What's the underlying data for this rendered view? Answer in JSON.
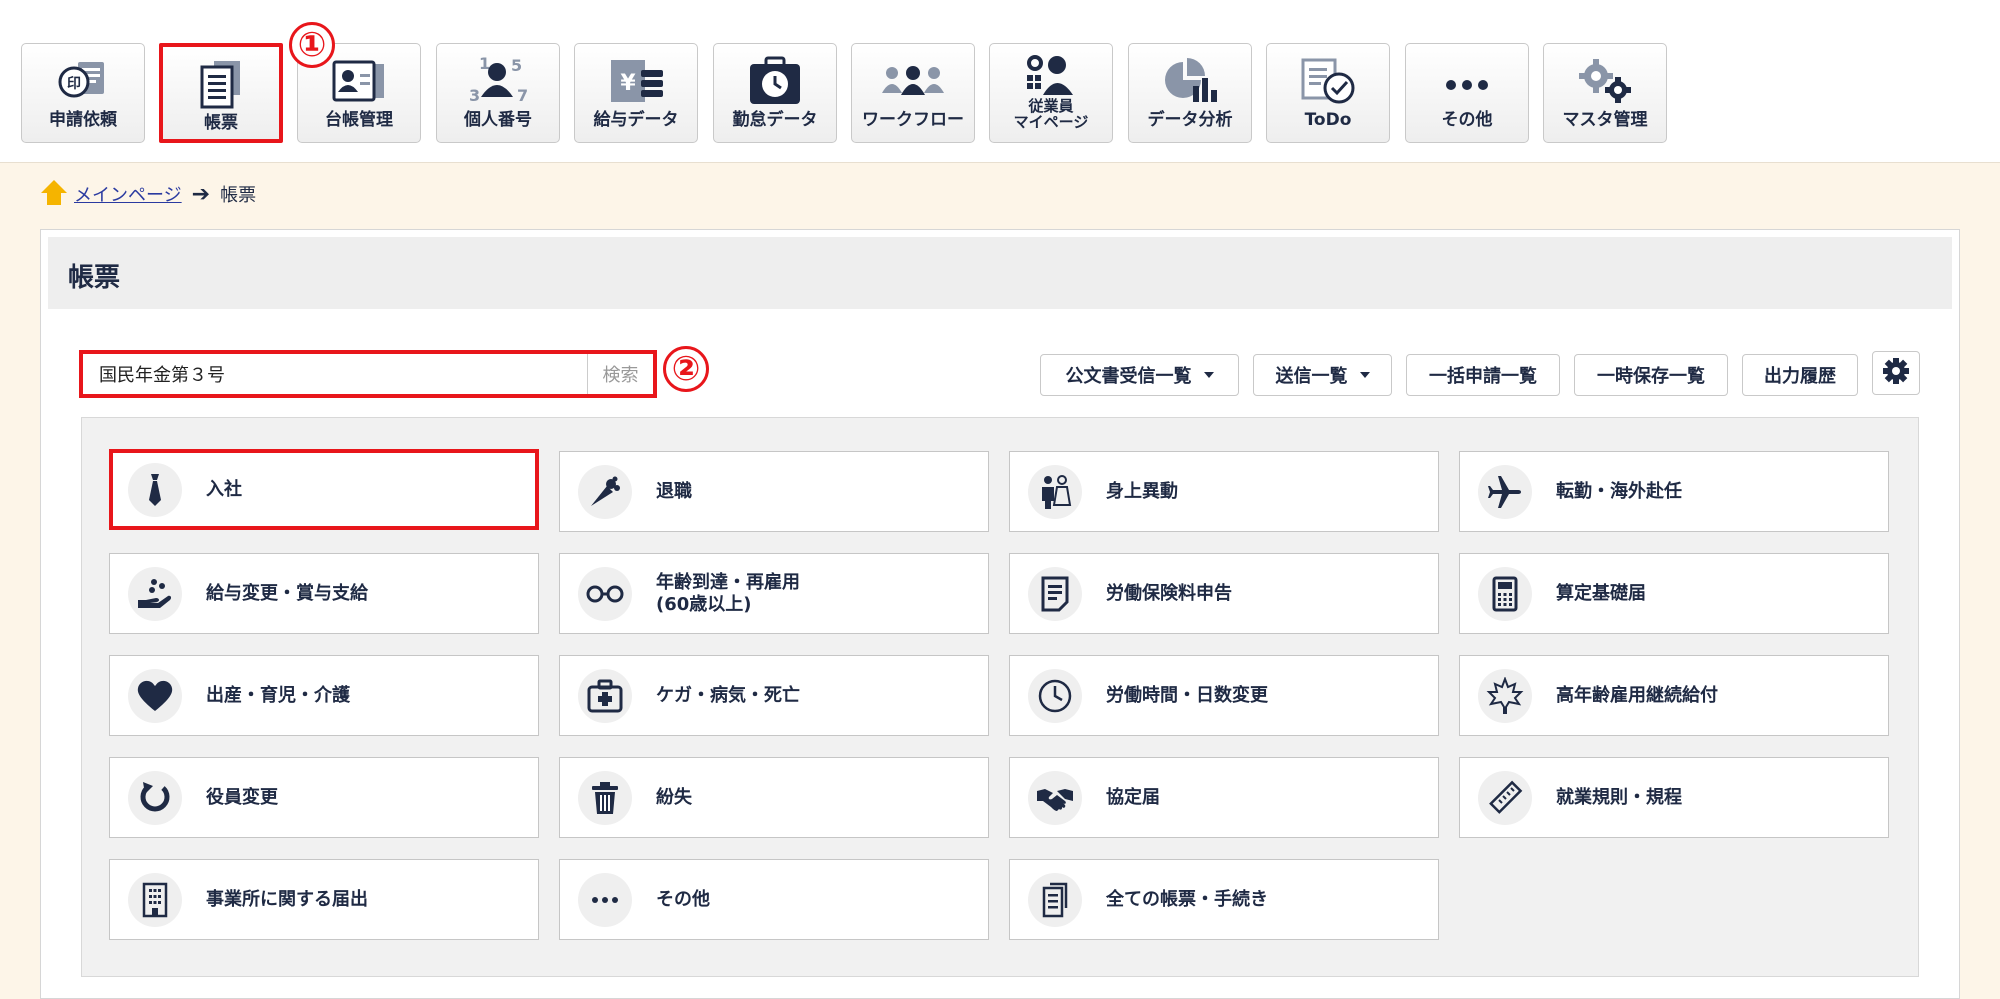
{
  "nav": {
    "items": [
      {
        "label": "申請依頼",
        "icon": "application-stamp-icon"
      },
      {
        "label": "帳票",
        "icon": "document-icon"
      },
      {
        "label": "台帳管理",
        "icon": "ledger-card-icon"
      },
      {
        "label": "個人番号",
        "icon": "personal-number-icon"
      },
      {
        "label": "給与データ",
        "icon": "salary-data-icon"
      },
      {
        "label": "勤怠データ",
        "icon": "attendance-clock-icon"
      },
      {
        "label": "ワークフロー",
        "icon": "workflow-icon"
      },
      {
        "label": "従業員\nマイページ",
        "icon": "employee-mypage-icon"
      },
      {
        "label": "データ分析",
        "icon": "data-analysis-icon"
      },
      {
        "label": "ToDo",
        "icon": "todo-check-icon"
      },
      {
        "label": "その他",
        "icon": "more-dots-icon"
      },
      {
        "label": "マスタ管理",
        "icon": "master-gear-icon"
      }
    ],
    "active_index": 1,
    "marker_1": "①",
    "marker_2": "②"
  },
  "breadcrumb": {
    "home": "メインページ",
    "current": "帳票"
  },
  "panel": {
    "title": "帳票"
  },
  "search": {
    "value": "国民年金第３号",
    "button": "検索"
  },
  "toolbar": {
    "incoming": "公文書受信一覧",
    "sent": "送信一覧",
    "bulk": "一括申請一覧",
    "temp": "一時保存一覧",
    "history": "出力履歴",
    "settings_icon": "gear-icon"
  },
  "categories": [
    {
      "label": "入社",
      "icon": "necktie-icon",
      "highlighted": true
    },
    {
      "label": "退職",
      "icon": "bouquet-icon"
    },
    {
      "label": "身上異動",
      "icon": "wedding-couple-icon"
    },
    {
      "label": "転勤・海外赴任",
      "icon": "airplane-icon"
    },
    {
      "label": "給与変更・賞与支給",
      "icon": "hand-coins-icon"
    },
    {
      "label": "年齢到達・再雇用\n(60歳以上)",
      "icon": "glasses-icon"
    },
    {
      "label": "労働保険料申告",
      "icon": "document-lines-icon"
    },
    {
      "label": "算定基礎届",
      "icon": "calculator-icon"
    },
    {
      "label": "出産・育児・介護",
      "icon": "heart-icon"
    },
    {
      "label": "ケガ・病気・死亡",
      "icon": "first-aid-kit-icon"
    },
    {
      "label": "労働時間・日数変更",
      "icon": "clock-icon"
    },
    {
      "label": "高年齢雇用継続給付",
      "icon": "maple-leaf-icon"
    },
    {
      "label": "役員変更",
      "icon": "refresh-icon"
    },
    {
      "label": "紛失",
      "icon": "trash-icon"
    },
    {
      "label": "協定届",
      "icon": "handshake-icon"
    },
    {
      "label": "就業規則・規程",
      "icon": "ruler-icon"
    },
    {
      "label": "事業所に関する届出",
      "icon": "building-icon"
    },
    {
      "label": "その他",
      "icon": "more-dots-icon"
    },
    {
      "label": "全ての帳票・手続き",
      "icon": "documents-stack-icon"
    }
  ],
  "colors": {
    "accent": "#e8161b",
    "navy": "#1f2a44",
    "background": "#fdf5e8"
  }
}
